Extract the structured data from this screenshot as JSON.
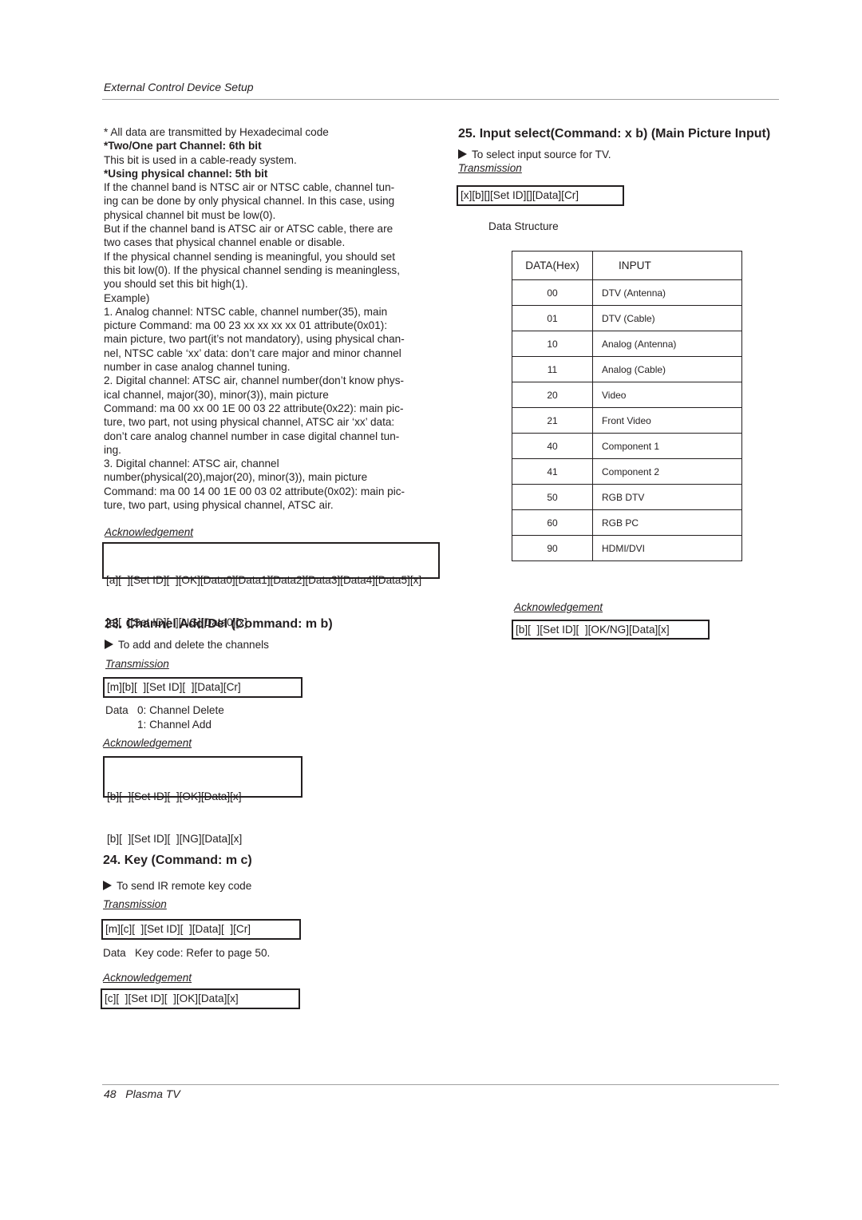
{
  "header": {
    "title": "External Control Device Setup"
  },
  "left_intro": {
    "lines": [
      {
        "text": "* All data are transmitted by Hexadecimal code",
        "bold": false
      },
      {
        "text": "*Two/One part Channel: 6th bit",
        "bold": true
      },
      {
        "text": "This bit is used in a cable-ready system.",
        "bold": false
      },
      {
        "text": "*Using physical channel: 5th bit",
        "bold": true
      },
      {
        "text": "If the channel band is NTSC air or NTSC cable, channel tun-",
        "bold": false
      },
      {
        "text": "ing can be done by only physical channel. In this case, using",
        "bold": false
      },
      {
        "text": "physical channel bit must be low(0).",
        "bold": false
      },
      {
        "text": "But if the channel band is ATSC air or ATSC cable, there are",
        "bold": false
      },
      {
        "text": "two cases that physical channel enable or disable.",
        "bold": false
      },
      {
        "text": "If the physical channel sending is meaningful, you should set",
        "bold": false
      },
      {
        "text": "this bit low(0). If the physical channel sending is meaningless,",
        "bold": false
      },
      {
        "text": "you should set this bit high(1).",
        "bold": false
      },
      {
        "text": "Example)",
        "bold": false
      },
      {
        "text": "1. Analog channel: NTSC cable, channel number(35), main",
        "bold": false
      },
      {
        "text": "picture Command: ma 00 23 xx xx xx xx 01 attribute(0x01):",
        "bold": false
      },
      {
        "text": "main picture, two part(it’s not mandatory), using physical chan-",
        "bold": false
      },
      {
        "text": "nel, NTSC cable ‘xx’ data: don’t care major and minor channel",
        "bold": false
      },
      {
        "text": "number in case analog channel tuning.",
        "bold": false
      },
      {
        "text": "2. Digital channel: ATSC air, channel number(don’t know phys-",
        "bold": false
      },
      {
        "text": "ical channel, major(30), minor(3)), main picture",
        "bold": false
      },
      {
        "text": "Command: ma 00 xx 00 1E 00 03 22 attribute(0x22): main pic-",
        "bold": false
      },
      {
        "text": "ture, two part, not using physical channel, ATSC air ‘xx’ data:",
        "bold": false
      },
      {
        "text": "don’t care analog channel number in case digital channel tun-",
        "bold": false
      },
      {
        "text": "ing.",
        "bold": false
      },
      {
        "text": "3. Digital channel: ATSC air, channel",
        "bold": false
      },
      {
        "text": "number(physical(20),major(20), minor(3)), main picture",
        "bold": false
      },
      {
        "text": "Command: ma 00 14 00 1E 00 03 02 attribute(0x02): main pic-",
        "bold": false
      },
      {
        "text": "ture, two part, using physical channel, ATSC air.",
        "bold": false
      }
    ],
    "ack_label": "Acknowledgement",
    "ack_box": [
      "[a][  ][Set ID][  ][OK][Data0][Data1][Data2][Data3][Data4][Data5][x]",
      "[a][  ][Set ID][  ][NG][Data0][x]"
    ]
  },
  "section23": {
    "title": "23. Channel Add/Del (Command: m b)",
    "desc": "To add and delete the channels",
    "transmission_label": "Transmission",
    "transmission_box": "[m][b][  ][Set ID][  ][Data][Cr]",
    "data_label": "Data",
    "data_values": [
      "0: Channel Delete",
      "1: Channel Add"
    ],
    "ack_label": "Acknowledgement",
    "ack_box": [
      "[b][  ][Set ID][  ][OK][Data][x]",
      "[b][  ][Set ID][  ][NG][Data][x]"
    ]
  },
  "section24": {
    "title": "24. Key (Command: m c)",
    "desc": "To send IR remote key code",
    "transmission_label": "Transmission",
    "transmission_box": "[m][c][  ][Set ID][  ][Data][  ][Cr]",
    "data_line": "Data   Key code: Refer to page 50.",
    "ack_label": "Acknowledgement",
    "ack_box": "[c][  ][Set ID][  ][OK][Data][x]"
  },
  "section25": {
    "title": "25. Input select(Command: x b) (Main Picture Input)",
    "desc": "To select input source for TV.",
    "transmission_label": "Transmission",
    "transmission_box": "[x][b][][Set ID][][Data][Cr]",
    "data_structure_label": "Data Structure",
    "table": {
      "headers": [
        "DATA(Hex)",
        "INPUT"
      ],
      "rows": [
        [
          "00",
          "DTV (Antenna)"
        ],
        [
          "01",
          "DTV (Cable)"
        ],
        [
          "10",
          "Analog (Antenna)"
        ],
        [
          "11",
          "Analog (Cable)"
        ],
        [
          "20",
          "Video"
        ],
        [
          "21",
          "Front Video"
        ],
        [
          "40",
          "Component 1"
        ],
        [
          "41",
          "Component 2"
        ],
        [
          "50",
          "RGB DTV"
        ],
        [
          "60",
          "RGB PC"
        ],
        [
          "90",
          "HDMI/DVI"
        ]
      ]
    },
    "ack_label": "Acknowledgement",
    "ack_box": "[b][  ][Set ID][  ][OK/NG][Data][x]"
  },
  "footer": {
    "page": "48",
    "title": "Plasma TV"
  }
}
